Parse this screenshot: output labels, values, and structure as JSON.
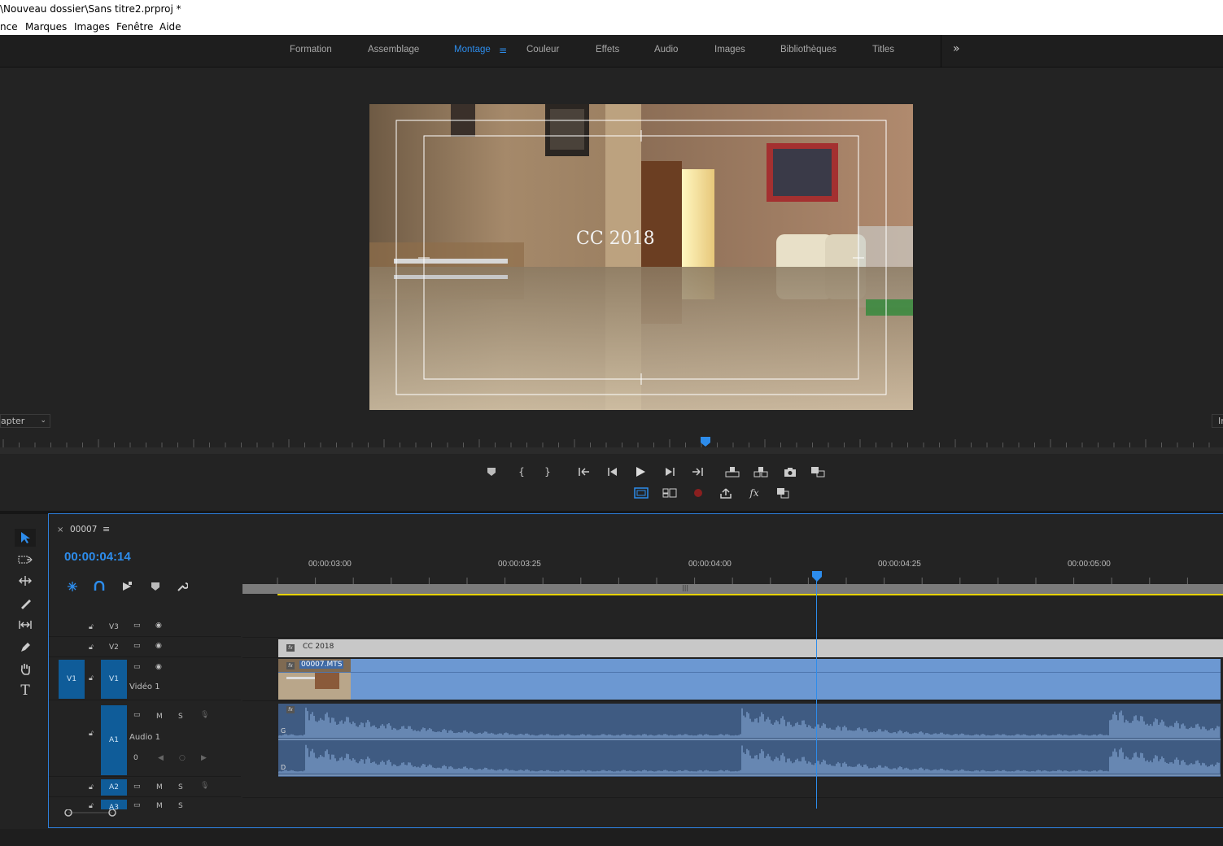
{
  "window": {
    "title": "\\Nouveau dossier\\Sans titre2.prproj *"
  },
  "menu": [
    "nce",
    "Marques",
    "Images",
    "Fenêtre",
    "Aide"
  ],
  "workspaces": {
    "tabs": [
      "Formation",
      "Assemblage",
      "Montage",
      "Couleur",
      "Effets",
      "Audio",
      "Images",
      "Bibliothèques",
      "Titles"
    ],
    "active": "Montage",
    "more_label": "»"
  },
  "program_monitor": {
    "title_overlay": "CC 2018",
    "fit_select": "apter",
    "right_select": "In",
    "playhead_fraction": 0.577
  },
  "timeline": {
    "sequence_name": "00007",
    "close_label": "×",
    "menu_label": "≡",
    "timecode": "00:00:04:14",
    "ruler_labels": [
      "00:00:03:00",
      "00:00:03:25",
      "00:00:04:00",
      "00:00:04:25",
      "00:00:05:00"
    ],
    "video_tracks": [
      {
        "name": "V3",
        "label": ""
      },
      {
        "name": "V2",
        "label": ""
      },
      {
        "name": "V1",
        "source": "V1",
        "label": "Vidéo 1"
      }
    ],
    "audio_tracks": [
      {
        "name": "A1",
        "label": "Audio 1",
        "mute": "M",
        "solo": "S",
        "volume": "0"
      },
      {
        "name": "A2",
        "mute": "M",
        "solo": "S"
      },
      {
        "name": "A3",
        "mute": "M",
        "solo": "S"
      }
    ],
    "clips": {
      "title_clip": "CC 2018",
      "video_clip": "00007.MTS",
      "audio_left": "G",
      "audio_right": "D",
      "fx": "fx"
    }
  },
  "colors": {
    "accent": "#2d8ceb",
    "video_clip": "#6c98d2",
    "audio_clip": "#3f5b82",
    "title_clip": "#c8c8c8",
    "in_out_bar": "#e6d200"
  }
}
